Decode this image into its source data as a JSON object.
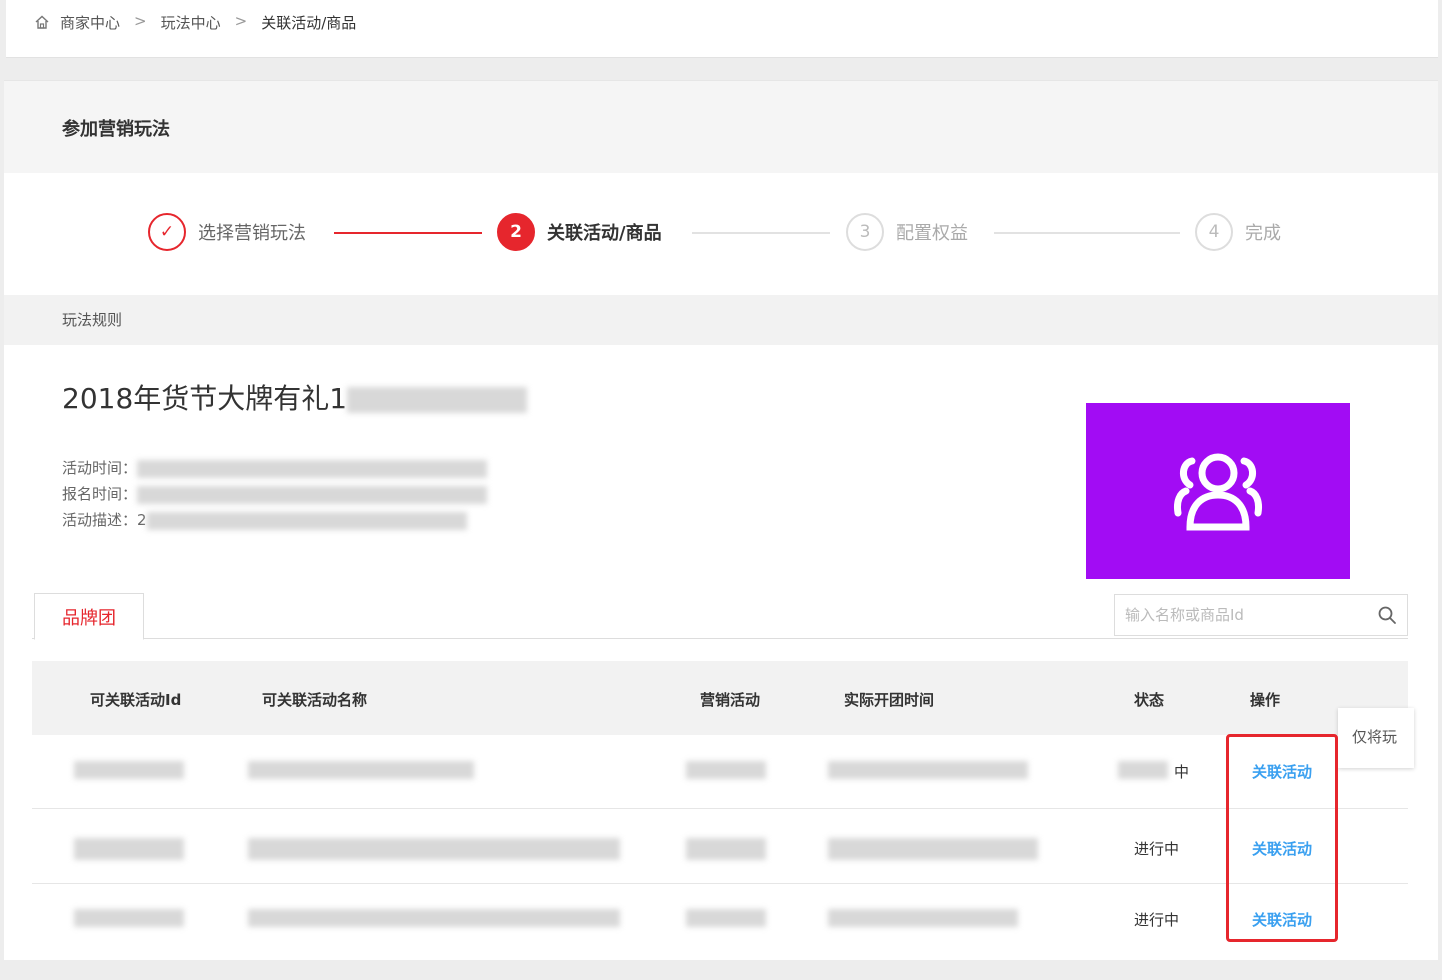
{
  "breadcrumb": {
    "items": [
      "商家中心",
      "玩法中心",
      "关联活动/商品"
    ],
    "separator": ">"
  },
  "card": {
    "title": "参加营销玩法"
  },
  "steps": [
    {
      "marker": "✓",
      "label": "选择营销玩法",
      "state": "done"
    },
    {
      "marker": "2",
      "label": "关联活动/商品",
      "state": "active"
    },
    {
      "marker": "3",
      "label": "配置权益",
      "state": "todo"
    },
    {
      "marker": "4",
      "label": "完成",
      "state": "todo"
    }
  ],
  "rules": {
    "title": "玩法规则"
  },
  "activity": {
    "title": "2018年货节大牌有礼1",
    "time_label": "活动时间：",
    "signup_label": "报名时间：",
    "desc_label": "活动描述：",
    "desc_prefix": "2"
  },
  "tabs": [
    {
      "label": "品牌团",
      "active": true
    }
  ],
  "search": {
    "placeholder": "输入名称或商品Id"
  },
  "table": {
    "headers": [
      "可关联活动Id",
      "可关联活动名称",
      "营销活动",
      "实际开团时间",
      "状态",
      "操作"
    ],
    "rows": [
      {
        "status": "中",
        "action": "关联活动"
      },
      {
        "status": "进行中",
        "action": "关联活动"
      },
      {
        "status": "进行中",
        "action": "关联活动"
      }
    ]
  },
  "tooltip": {
    "text": "仅将玩"
  },
  "colors": {
    "accent": "#e6262d",
    "link": "#3aa0f0",
    "poster": "#a20cf4"
  }
}
